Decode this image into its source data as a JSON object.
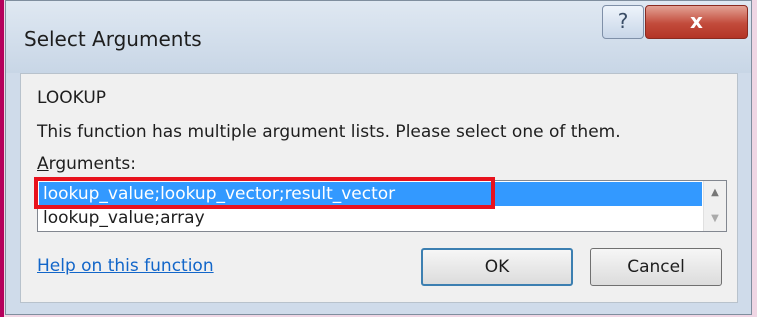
{
  "dialog": {
    "title": "Select Arguments",
    "help_glyph": "?",
    "close_glyph": "x"
  },
  "function_name": "LOOKUP",
  "description": "This function has multiple argument lists.  Please select one of them.",
  "arguments_label_accel": "A",
  "arguments_label_rest": "rguments:",
  "argument_lists": [
    "lookup_value;lookup_vector;result_vector",
    "lookup_value;array"
  ],
  "selected_index": 0,
  "help_link": "Help on this function",
  "buttons": {
    "ok": "OK",
    "cancel": "Cancel"
  },
  "colors": {
    "selection": "#3399ff",
    "annotation": "#e8121d",
    "close": "#c24b3b",
    "link": "#1266c9"
  },
  "icons": {
    "scroll_up": "scroll-up-icon",
    "scroll_down": "scroll-down-icon"
  }
}
